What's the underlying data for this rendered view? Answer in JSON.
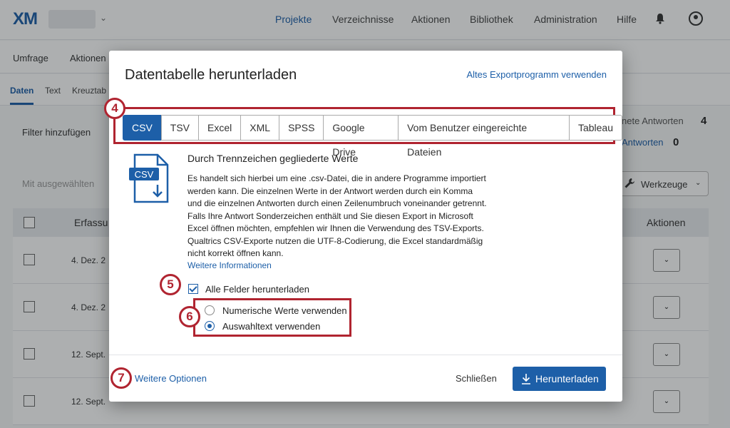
{
  "topnav": {
    "logo": "XM",
    "items": [
      "Projekte",
      "Verzeichnisse",
      "Aktionen",
      "Bibliothek",
      "Administration",
      "Hilfe"
    ]
  },
  "subnav": {
    "items": [
      "Umfrage",
      "Aktionen"
    ]
  },
  "tabs": {
    "items": [
      "Daten",
      "Text",
      "Kreuztab"
    ]
  },
  "page": {
    "filter_label": "Filter hinzufügen",
    "stat1_label": "nete Antworten",
    "stat1_value": "4",
    "stat2_label": "Antworten",
    "stat2_value": "0",
    "bulk_label": "Mit ausgewählten",
    "tools_label": "Werkzeuge"
  },
  "table": {
    "col_date": "Erfassu",
    "col_actions": "Aktionen",
    "rows": [
      {
        "date": "4. Dez. 2"
      },
      {
        "date": "4. Dez. 2"
      },
      {
        "date": "12. Sept."
      },
      {
        "date": "12. Sept."
      }
    ]
  },
  "modal": {
    "title": "Datentabelle herunterladen",
    "old_export_link": "Altes Exportprogramm verwenden",
    "formats": [
      "CSV",
      "TSV",
      "Excel",
      "XML",
      "SPSS",
      "Google Drive",
      "Vom Benutzer eingereichte Dateien",
      "Tableau"
    ],
    "active_format": "CSV",
    "icon_label": "CSV",
    "desc_title": "Durch Trennzeichen gegliederte Werte",
    "desc_body": "Es handelt sich hierbei um eine .csv-Datei, die in andere Programme importiert werden kann. Die einzelnen Werte in der Antwort werden durch ein Komma und die einzelnen Antworten durch einen Zeilenumbruch voneinander getrennt. Falls Ihre Antwort Sonderzeichen enthält und Sie diesen Export in Microsoft Excel öffnen möchten, empfehlen wir Ihnen die Verwendung des TSV-Exports. Qualtrics CSV-Exporte nutzen die UTF-8-Codierung, die Excel standardmäßig nicht korrekt öffnen kann.",
    "more_info_link": "Weitere Informationen",
    "all_fields_label": "Alle Felder herunterladen",
    "radio_numeric": "Numerische Werte verwenden",
    "radio_choice": "Auswahltext verwenden",
    "more_options_link": "Weitere Optionen",
    "close_label": "Schließen",
    "download_label": "Herunterladen"
  },
  "badges": {
    "b4": "4",
    "b5": "5",
    "b6": "6",
    "b7": "7"
  },
  "colors": {
    "accent": "#1d5fa8",
    "highlight": "#b02430"
  }
}
